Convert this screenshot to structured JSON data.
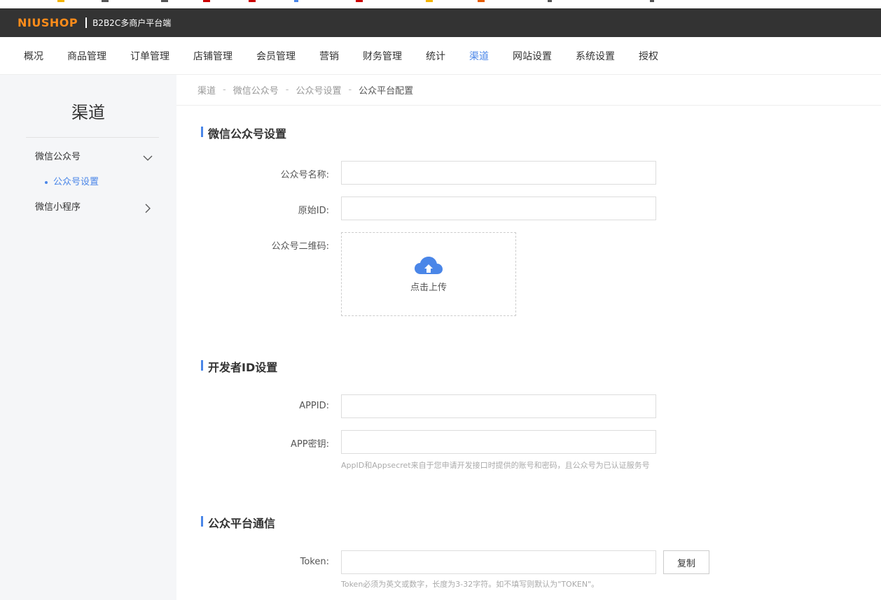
{
  "header": {
    "logo_text": "NIUSHOP",
    "subtitle": "B2B2C多商户平台端"
  },
  "mainnav": {
    "items": [
      "概况",
      "商品管理",
      "订单管理",
      "店铺管理",
      "会员管理",
      "营销",
      "财务管理",
      "统计",
      "渠道",
      "网站设置",
      "系统设置",
      "授权"
    ],
    "active": "渠道"
  },
  "sidebar": {
    "title": "渠道",
    "groups": [
      {
        "label": "微信公众号",
        "expanded": true,
        "icon": "chevron-down-icon",
        "sub": [
          "公众号设置"
        ]
      },
      {
        "label": "微信小程序",
        "expanded": false,
        "icon": "chevron-right-icon"
      }
    ]
  },
  "breadcrumb": [
    "渠道",
    "微信公众号",
    "公众号设置",
    "公众平台配置"
  ],
  "sections": {
    "wechat": {
      "title": "微信公众号设置",
      "name_label": "公众号名称:",
      "name_value": "",
      "origin_label": "原始ID:",
      "origin_value": "",
      "qr_label": "公众号二维码:",
      "upload_text": "点击上传"
    },
    "developer": {
      "title": "开发者ID设置",
      "appid_label": "APPID:",
      "appid_value": "",
      "secret_label": "APP密钥:",
      "secret_value": "",
      "hint": "AppID和Appsecret来自于您申请开发接口时提供的账号和密码，且公众号为已认证服务号"
    },
    "platform": {
      "title": "公众平台通信",
      "token_label": "Token:",
      "token_value": "",
      "copy_label": "复制",
      "hint": "Token必须为英文或数字，长度为3-32字符。如不填写则默认为\"TOKEN\"。"
    }
  },
  "colors": {
    "accent": "#4a86e8",
    "header_bg": "#333333",
    "logo": "#ff8c1a",
    "sidebar_bg": "#f5f6f8"
  }
}
